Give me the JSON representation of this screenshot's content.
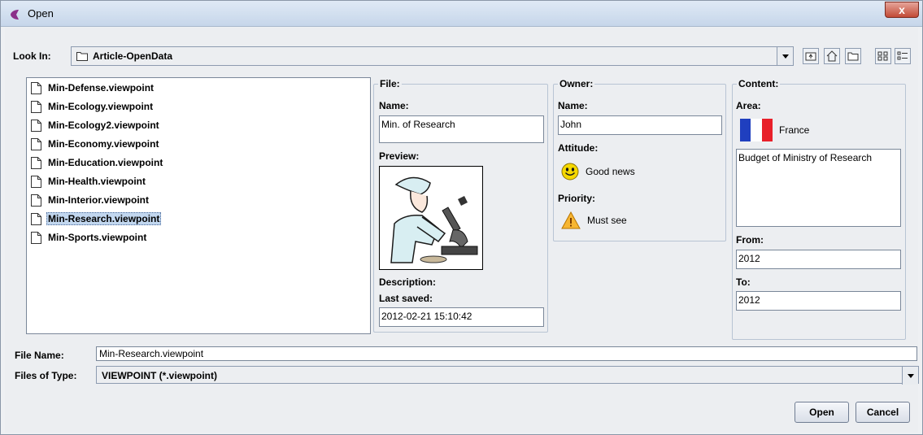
{
  "window": {
    "title": "Open",
    "close_label": "x"
  },
  "look_in": {
    "label": "Look In:",
    "value": "Article-OpenData"
  },
  "toolbar": [
    "up-one-level-icon",
    "home-icon",
    "new-folder-icon",
    "list-view-icon",
    "details-view-icon"
  ],
  "files": [
    {
      "name": "Min-Defense.viewpoint",
      "selected": false
    },
    {
      "name": "Min-Ecology.viewpoint",
      "selected": false
    },
    {
      "name": "Min-Ecology2.viewpoint",
      "selected": false
    },
    {
      "name": "Min-Economy.viewpoint",
      "selected": false
    },
    {
      "name": "Min-Education.viewpoint",
      "selected": false
    },
    {
      "name": "Min-Health.viewpoint",
      "selected": false
    },
    {
      "name": "Min-Interior.viewpoint",
      "selected": false
    },
    {
      "name": "Min-Research.viewpoint",
      "selected": true
    },
    {
      "name": "Min-Sports.viewpoint",
      "selected": false
    }
  ],
  "file_panel": {
    "title": "File:",
    "name_label": "Name:",
    "name_value": "Min. of Research",
    "preview_label": "Preview:",
    "description_label": "Description:",
    "last_saved_label": "Last saved:",
    "last_saved_value": "2012-02-21 15:10:42"
  },
  "owner_panel": {
    "title": "Owner:",
    "name_label": "Name:",
    "name_value": "John",
    "attitude_label": "Attitude:",
    "attitude_value": "Good news",
    "priority_label": "Priority:",
    "priority_value": "Must see"
  },
  "content_panel": {
    "title": "Content:",
    "area_label": "Area:",
    "area_value": "France",
    "text_value": "Budget of Ministry of Research",
    "from_label": "From:",
    "from_value": "2012",
    "to_label": "To:",
    "to_value": "2012"
  },
  "bottom": {
    "file_name_label": "File Name:",
    "file_name_value": "Min-Research.viewpoint",
    "files_of_type_label": "Files of Type:",
    "files_of_type_value": "VIEWPOINT (*.viewpoint)"
  },
  "buttons": {
    "open": "Open",
    "cancel": "Cancel"
  },
  "colors": {
    "selection": "#c2d7ef",
    "flag_blue": "#1f3fbf",
    "flag_red": "#e8202a",
    "close_red": "#c24a36"
  }
}
